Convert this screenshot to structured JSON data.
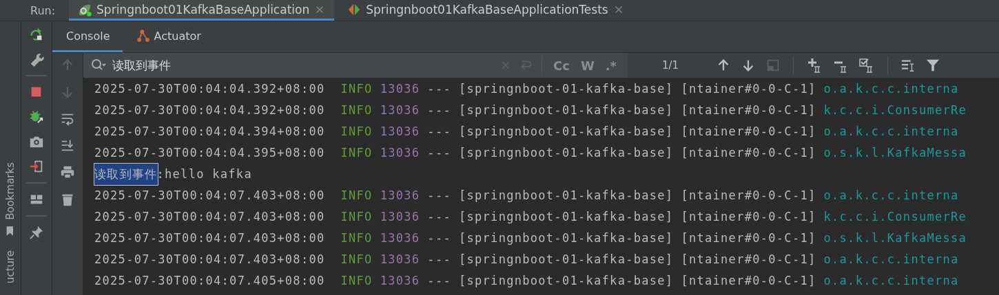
{
  "run_bar": {
    "label": "Run:",
    "tabs": [
      {
        "label": "Springnboot01KafkaBaseApplication",
        "selected": true,
        "kind": "app"
      },
      {
        "label": "Springnboot01KafkaBaseApplicationTests",
        "selected": false,
        "kind": "tests"
      }
    ]
  },
  "side_tabs": [
    {
      "label": "Bookmarks",
      "kind": "bookmarks"
    },
    {
      "label": "ucture",
      "kind": "plain"
    }
  ],
  "console_tabs": [
    {
      "label": "Console",
      "selected": true,
      "kind": "console"
    },
    {
      "label": "Actuator",
      "selected": false,
      "kind": "actuator"
    }
  ],
  "search": {
    "value": "读取到事件",
    "match_count": "1/1",
    "options": [
      "Cc",
      "W",
      ".*"
    ]
  },
  "lines": [
    {
      "kind": "log",
      "time": "2025-07-30T00:04:04.392+08:00",
      "level": "INFO",
      "pid": "13036",
      "sep": "---",
      "app": "[springnboot-01-kafka-base]",
      "thread": "[ntainer#0-0-C-1]",
      "logger": "o.a.k.c.c.interna"
    },
    {
      "kind": "log",
      "time": "2025-07-30T00:04:04.392+08:00",
      "level": "INFO",
      "pid": "13036",
      "sep": "---",
      "app": "[springnboot-01-kafka-base]",
      "thread": "[ntainer#0-0-C-1]",
      "logger": "k.c.c.i.ConsumerRe"
    },
    {
      "kind": "log",
      "time": "2025-07-30T00:04:04.394+08:00",
      "level": "INFO",
      "pid": "13036",
      "sep": "---",
      "app": "[springnboot-01-kafka-base]",
      "thread": "[ntainer#0-0-C-1]",
      "logger": "o.a.k.c.c.interna"
    },
    {
      "kind": "log",
      "time": "2025-07-30T00:04:04.395+08:00",
      "level": "INFO",
      "pid": "13036",
      "sep": "---",
      "app": "[springnboot-01-kafka-base]",
      "thread": "[ntainer#0-0-C-1]",
      "logger": "o.s.k.l.KafkaMessa"
    },
    {
      "kind": "output",
      "match": "读取到事件",
      "text": ":hello kafka"
    },
    {
      "kind": "log",
      "time": "2025-07-30T00:04:07.403+08:00",
      "level": "INFO",
      "pid": "13036",
      "sep": "---",
      "app": "[springnboot-01-kafka-base]",
      "thread": "[ntainer#0-0-C-1]",
      "logger": "o.a.k.c.c.interna"
    },
    {
      "kind": "log",
      "time": "2025-07-30T00:04:07.403+08:00",
      "level": "INFO",
      "pid": "13036",
      "sep": "---",
      "app": "[springnboot-01-kafka-base]",
      "thread": "[ntainer#0-0-C-1]",
      "logger": "k.c.c.i.ConsumerRe"
    },
    {
      "kind": "log",
      "time": "2025-07-30T00:04:07.403+08:00",
      "level": "INFO",
      "pid": "13036",
      "sep": "---",
      "app": "[springnboot-01-kafka-base]",
      "thread": "[ntainer#0-0-C-1]",
      "logger": "o.s.k.l.KafkaMessa"
    },
    {
      "kind": "log",
      "time": "2025-07-30T00:04:07.403+08:00",
      "level": "INFO",
      "pid": "13036",
      "sep": "---",
      "app": "[springnboot-01-kafka-base]",
      "thread": "[ntainer#0-0-C-1]",
      "logger": "o.a.k.c.c.interna"
    },
    {
      "kind": "log",
      "time": "2025-07-30T00:04:07.405+08:00",
      "level": "INFO",
      "pid": "13036",
      "sep": "---",
      "app": "[springnboot-01-kafka-base]",
      "thread": "[ntainer#0-0-C-1]",
      "logger": "o.a.k.c.c.interna"
    }
  ]
}
